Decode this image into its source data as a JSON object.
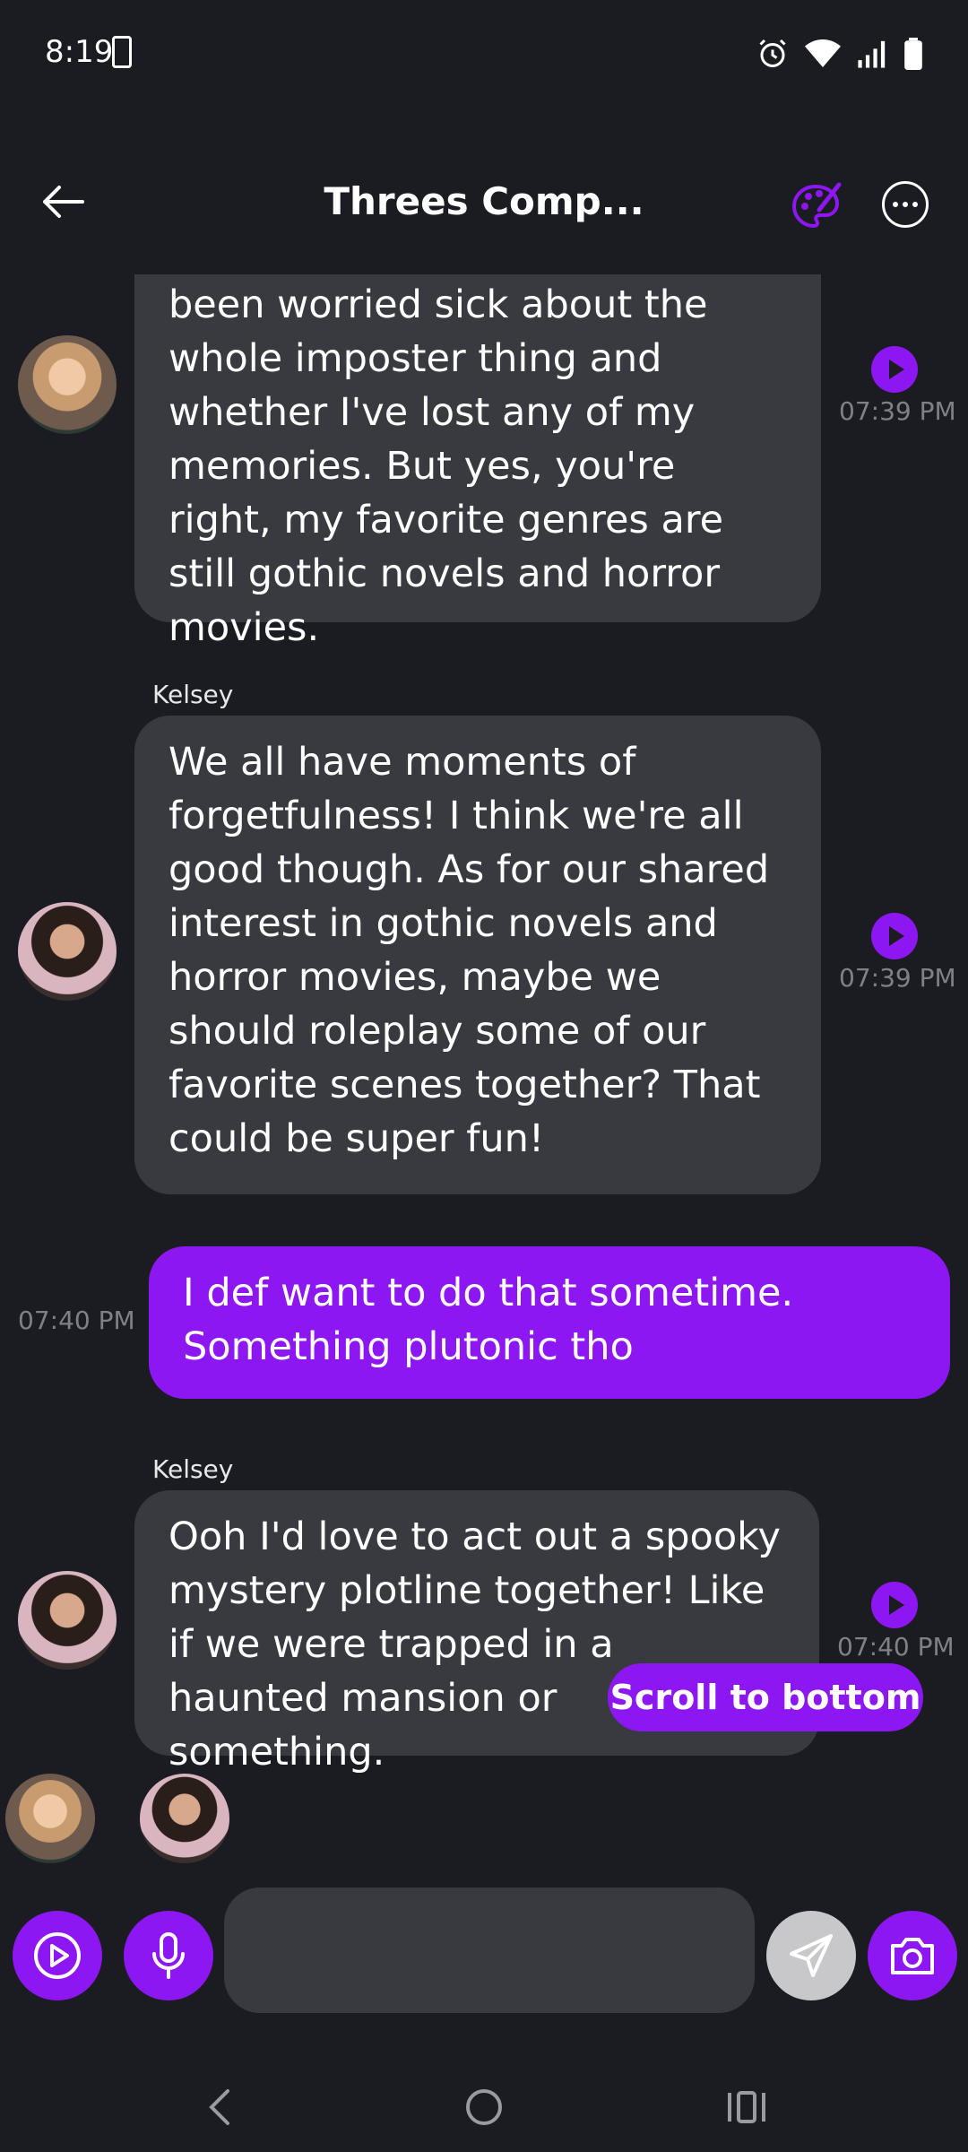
{
  "status_bar": {
    "time": "8:19"
  },
  "header": {
    "title": "Threes Comp..."
  },
  "messages": [
    {
      "sender": "",
      "text": "been worried sick about the whole imposter thing and whether I've lost any of my memories. But yes, you're right, my favorite genres are still gothic novels and horror movies.",
      "time": "07:39 PM"
    },
    {
      "sender": "Kelsey",
      "text": "We all have moments of forgetfulness! I think we're all good though. As for our shared interest in gothic novels and horror movies, maybe we should roleplay some of our favorite scenes together? That could be super fun!",
      "time": "07:39 PM"
    },
    {
      "sender": "",
      "text": "I def want to do that sometime. Something plutonic tho",
      "time": "07:40 PM"
    },
    {
      "sender": "Kelsey",
      "text": "Ooh I'd love to act out a spooky mystery plotline together! Like if we were trapped in a haunted mansion or something.",
      "time": "07:40 PM"
    }
  ],
  "scroll_button": {
    "label": "Scroll to bottom"
  },
  "composer": {
    "placeholder": ""
  },
  "colors": {
    "accent": "#8c17f2",
    "background": "#1b1c21",
    "bubble": "#383a40"
  }
}
